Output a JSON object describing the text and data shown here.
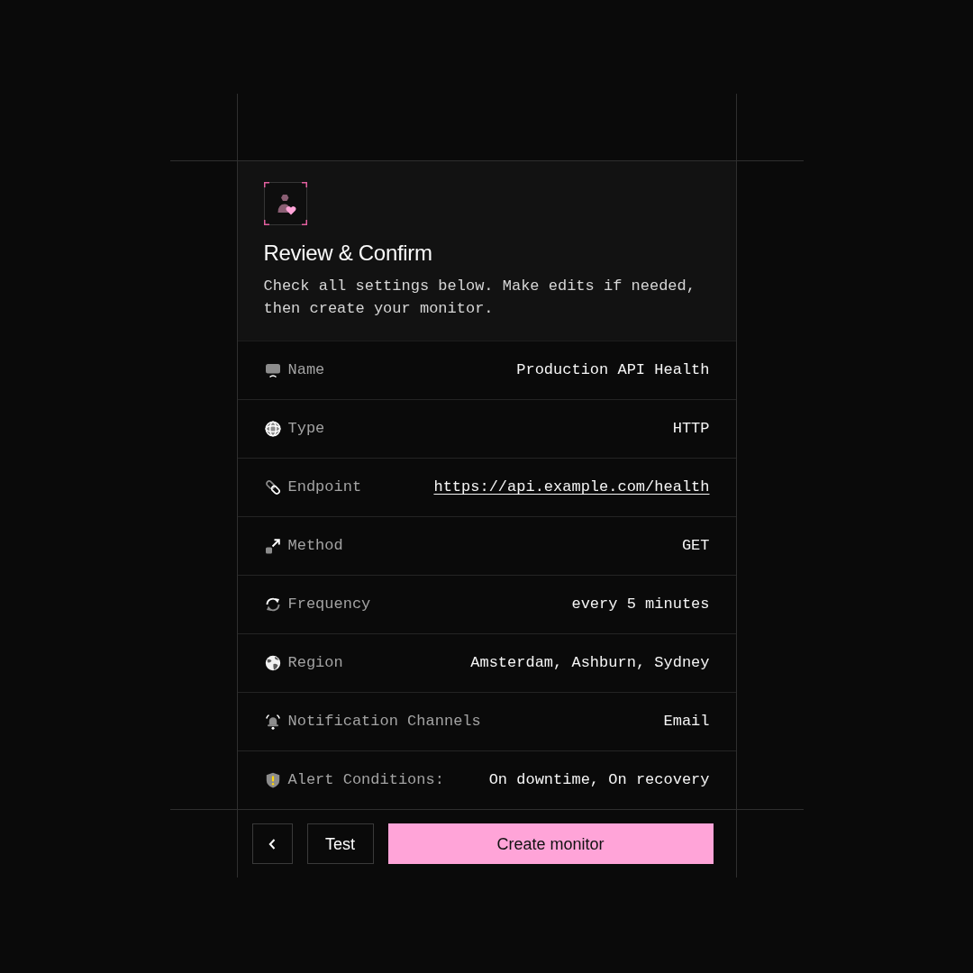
{
  "header": {
    "title": "Review & Confirm",
    "description": "Check all settings below. Make edits if needed, then create your monitor."
  },
  "rows": [
    {
      "label": "Name",
      "value": "Production API Health",
      "kind": "text"
    },
    {
      "label": "Type",
      "value": "HTTP",
      "kind": "text"
    },
    {
      "label": "Endpoint",
      "value": "https://api.example.com/health",
      "kind": "link"
    },
    {
      "label": "Method",
      "value": "GET",
      "kind": "text"
    },
    {
      "label": "Frequency",
      "value": "every 5 minutes",
      "kind": "text"
    },
    {
      "label": "Region",
      "value": "Amsterdam, Ashburn, Sydney",
      "kind": "text"
    },
    {
      "label": "Notification Channels",
      "value": "Email",
      "kind": "text"
    },
    {
      "label": "Alert Conditions:",
      "value": "On downtime, On recovery",
      "kind": "text"
    }
  ],
  "buttons": [
    {
      "kind": "back"
    },
    {
      "kind": "secondary",
      "label": "Test"
    },
    {
      "kind": "primary",
      "label": "Create monitor"
    }
  ]
}
